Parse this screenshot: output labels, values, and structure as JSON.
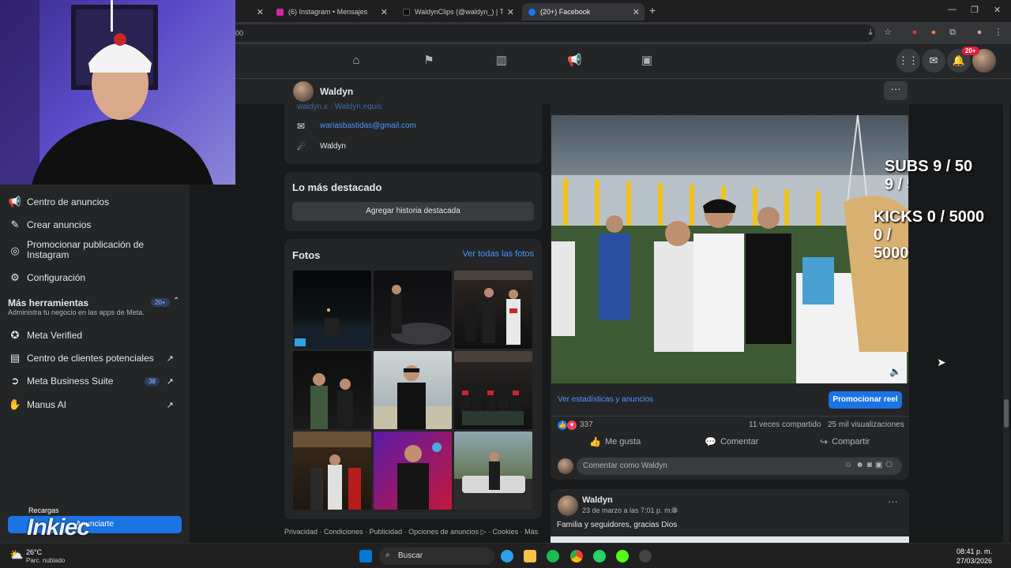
{
  "browser": {
    "tabs": [
      {
        "label": "(6) Instagram • Mensajes",
        "color": "#d6249f"
      },
      {
        "label": "WaldynClips (@waldyn_) | TikTok",
        "color": "#000000"
      },
      {
        "label": "(20+) Facebook",
        "color": "#1877f2"
      }
    ],
    "omnibox_text": "00"
  },
  "fb_nav": {
    "notif_badge": "20+"
  },
  "profile_header": {
    "name": "Waldyn"
  },
  "about": {
    "partial_handles": "waldyn.x · Waldyn.equis",
    "email": "wariasbastidas@gmail.com",
    "messenger": "Waldyn"
  },
  "featured": {
    "title": "Lo más destacado",
    "button": "Agregar historia destacada"
  },
  "photos": {
    "title": "Fotos",
    "see_all": "Ver todas las fotos"
  },
  "footer_links": "Privacidad · Condiciones · Publicidad · Opciones de anuncios ▷ · Cookies · Más",
  "sidebar": {
    "items": [
      {
        "label": "Centro de anuncios",
        "icon": "megaphone-icon"
      },
      {
        "label": "Crear anuncios",
        "icon": "edit-icon"
      },
      {
        "label": "Promocionar publicación de Instagram",
        "icon": "instagram-icon"
      },
      {
        "label": "Configuración",
        "icon": "gear-icon"
      }
    ],
    "more_tools_title": "Más herramientas",
    "more_tools_badge": "20+",
    "more_tools_sub": "Administra tu negocio en las apps de Meta.",
    "tools": [
      {
        "label": "Meta Verified",
        "icon": "verified-icon",
        "badge": "",
        "arrow": false
      },
      {
        "label": "Centro de clientes potenciales",
        "icon": "leads-icon",
        "badge": "",
        "arrow": true
      },
      {
        "label": "Meta Business Suite",
        "icon": "business-suite-icon",
        "badge": "38",
        "arrow": true
      },
      {
        "label": "Manus AI",
        "icon": "manus-icon",
        "badge": "",
        "arrow": true
      }
    ],
    "anunciarte_button": "Anunciarte",
    "overlay_recargas": "Recargas",
    "overlay_brand": "Inkiec"
  },
  "reel_post": {
    "overlay_subs": "SUBS 9 / 50",
    "overlay_kicks": "KICKS 0 / 5000",
    "stats_link": "Ver estadísticas y anuncios",
    "promote_button": "Promocionar reel",
    "reactions_count": "337",
    "shares": "11 veces compartido",
    "views": "25 mil visualizaciones",
    "like_label": "Me gusta",
    "comment_label": "Comentar",
    "share_label": "Compartir",
    "comment_placeholder": "Comentar como Waldyn"
  },
  "next_post": {
    "author": "Waldyn",
    "date": "23 de marzo a las 7:01 p. m. · ",
    "text": "Familia y seguidores, gracias Dios"
  },
  "taskbar": {
    "weather_temp": "26°C",
    "weather_desc": "Parc. nublado",
    "search_placeholder": "Buscar",
    "time": "08:41 p. m.",
    "date": "27/03/2026"
  }
}
